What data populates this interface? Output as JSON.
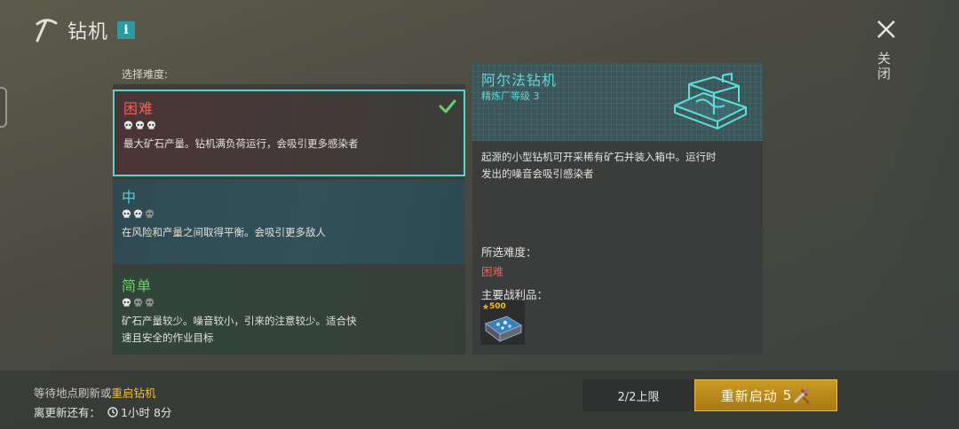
{
  "header": {
    "title": "钻机",
    "info_label": "i"
  },
  "close": {
    "label": "关闭"
  },
  "difficulty": {
    "label": "选择难度:",
    "options": [
      {
        "name": "困难",
        "skulls": 3,
        "description": "最大矿石产量。钻机满负荷运行，会吸引更多感染者",
        "selected": true
      },
      {
        "name": "中",
        "skulls": 2,
        "description": "在风险和产量之间取得平衡。会吸引更多敌人",
        "selected": false
      },
      {
        "name": "简单",
        "skulls": 1,
        "description_line1": "矿石产量较少。噪音较小，引来的注意较少。适合快",
        "description_line2": "速且安全的作业目标",
        "selected": false
      }
    ]
  },
  "detail": {
    "title": "阿尔法钻机",
    "subtitle": "精炼厂等级 3",
    "description_line1": "起源的小型钻机可开采稀有矿石并装入箱中。运行时",
    "description_line2": "发出的噪音会吸引感染者",
    "selected_label": "所选难度：",
    "selected_value": "困难",
    "loot_label": "主要战利品：",
    "loot_count": "500"
  },
  "footer": {
    "wait_text": "等待地点刷新或",
    "wait_link": "重启钻机",
    "timer_label": "离更新还有：",
    "timer_value": "1小时 8分",
    "limit": "2/2上限",
    "restart_label": "重新启动",
    "restart_cost": "5"
  },
  "colors": {
    "accent_cyan": "#56d6d0",
    "hard_red": "#f06058",
    "mid_cyan": "#58d0d8",
    "easy_green": "#6ad06a",
    "gold": "#f0c030"
  },
  "icons": [
    "pickaxe-icon",
    "info-icon",
    "close-icon",
    "skull-icon",
    "check-icon",
    "drill-icon",
    "ore-crate-icon",
    "star-icon",
    "clock-icon",
    "tool-icon"
  ]
}
